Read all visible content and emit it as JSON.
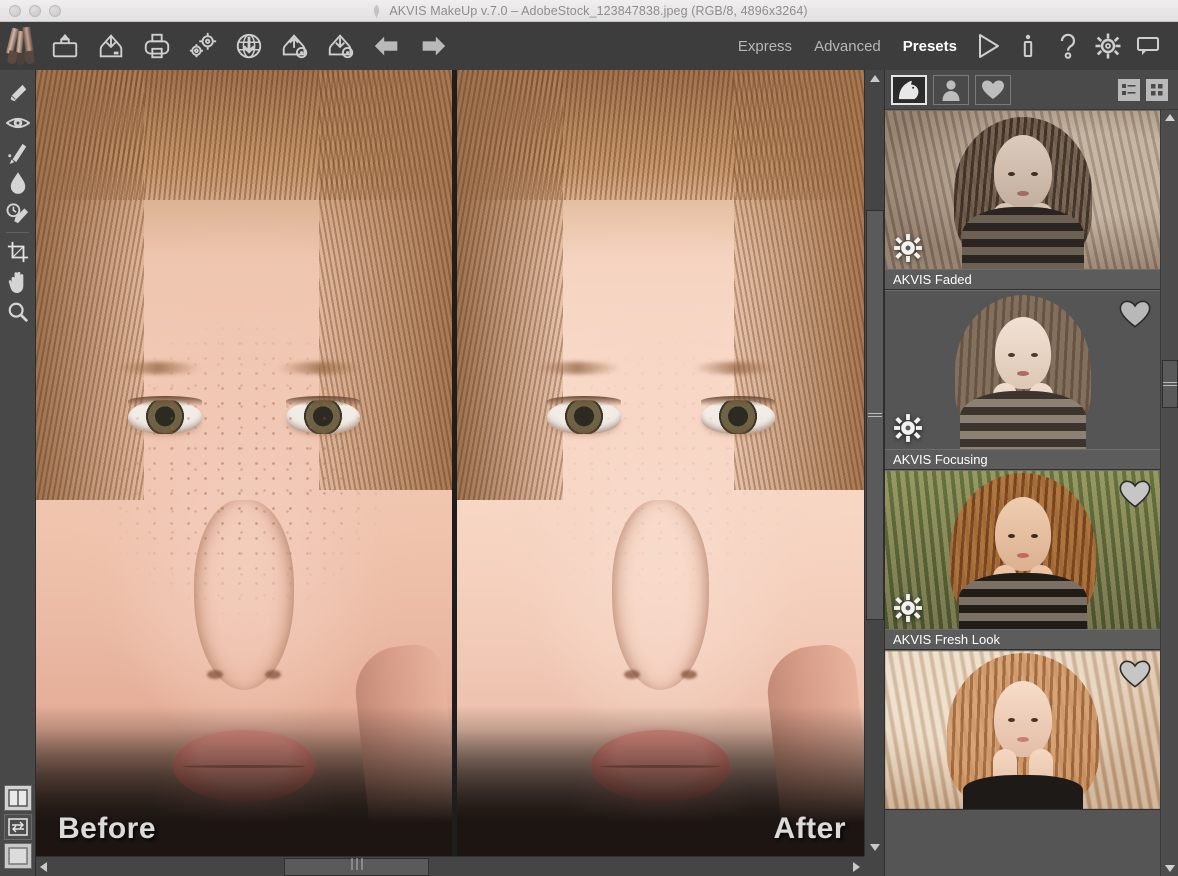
{
  "window": {
    "title": "AKVIS MakeUp v.7.0 – AdobeStock_123847838.jpeg (RGB/8, 4896x3264)",
    "app_icon": "akvis-logo-icon",
    "controls": [
      "close-button",
      "minimize-button",
      "zoom-button"
    ]
  },
  "toolbar": {
    "logo_icon": "makeup-brushes-logo-icon",
    "buttons": [
      {
        "name": "open-image-button",
        "icon": "open-folder-icon",
        "tooltip": "Open Image"
      },
      {
        "name": "save-image-button",
        "icon": "save-disk-icon",
        "tooltip": "Save Image"
      },
      {
        "name": "print-image-button",
        "icon": "printer-icon",
        "tooltip": "Print Image"
      },
      {
        "name": "preferences-button",
        "icon": "gears-icon",
        "tooltip": "Preferences"
      },
      {
        "name": "publish-web-button",
        "icon": "globe-download-icon",
        "tooltip": "Publish"
      },
      {
        "name": "export-presets-button",
        "icon": "export-presets-icon",
        "tooltip": "Export Presets"
      },
      {
        "name": "import-presets-button",
        "icon": "import-presets-icon",
        "tooltip": "Import Presets"
      },
      {
        "name": "undo-button",
        "icon": "left-arrow-icon",
        "tooltip": "Undo"
      },
      {
        "name": "redo-button",
        "icon": "right-arrow-icon",
        "tooltip": "Redo"
      }
    ],
    "modes": [
      {
        "label": "Express",
        "active": false
      },
      {
        "label": "Advanced",
        "active": false
      },
      {
        "label": "Presets",
        "active": true
      }
    ],
    "right_icons": [
      {
        "name": "run-button",
        "icon": "play-triangle-icon"
      },
      {
        "name": "about-button",
        "icon": "info-icon"
      },
      {
        "name": "help-button",
        "icon": "question-mark-icon"
      },
      {
        "name": "settings-button",
        "icon": "gear-icon"
      },
      {
        "name": "comments-button",
        "icon": "speech-bubble-icon"
      }
    ]
  },
  "left_toolbar": {
    "tools": [
      {
        "name": "tool-skin-smoothing",
        "icon": "skin-brush-icon",
        "active": false
      },
      {
        "name": "tool-red-eye",
        "icon": "eye-icon",
        "active": false
      },
      {
        "name": "tool-brush",
        "icon": "paint-brush-icon",
        "active": false
      },
      {
        "name": "tool-blur",
        "icon": "water-drop-icon",
        "active": false
      },
      {
        "name": "tool-history-brush",
        "icon": "history-brush-icon",
        "active": false
      },
      {
        "name": "tool-crop",
        "icon": "crop-icon",
        "active": false
      },
      {
        "name": "tool-hand",
        "icon": "hand-icon",
        "active": false
      },
      {
        "name": "tool-zoom",
        "icon": "magnifier-icon",
        "active": false
      }
    ],
    "view_modes": [
      {
        "name": "view-split-before-after",
        "icon": "split-view-icon",
        "active": true
      },
      {
        "name": "view-swap-before-after",
        "icon": "swap-view-icon",
        "active": false
      },
      {
        "name": "view-single",
        "icon": "single-view-icon",
        "active": false
      }
    ]
  },
  "canvas": {
    "before_label": "Before",
    "after_label": "After",
    "h_scrollbar": {
      "name": "canvas-h-scrollbar",
      "thumb_left_pct": 30,
      "thumb_width_pct": 31
    },
    "v_scrollbar": {
      "name": "canvas-v-scrollbar",
      "thumb_top_pct": 18,
      "thumb_height_pct": 52
    }
  },
  "right_panel": {
    "tabs": [
      {
        "name": "tab-akvis-presets",
        "icon": "akvis-horse-icon",
        "active": true
      },
      {
        "name": "tab-user-presets",
        "icon": "person-icon",
        "active": false
      },
      {
        "name": "tab-favorites",
        "icon": "heart-icon",
        "active": false
      }
    ],
    "view_buttons": [
      {
        "name": "view-list-button",
        "icon": "list-view-icon"
      },
      {
        "name": "view-grid-button",
        "icon": "grid-view-icon"
      }
    ],
    "presets": [
      {
        "label": "AKVIS Faded",
        "badge": "gear",
        "scene": "sepia"
      },
      {
        "label": "AKVIS Focusing",
        "badge": "heart",
        "scene": "soft"
      },
      {
        "label": "AKVIS Fresh Look",
        "badge": "heart",
        "scene": "vivid"
      },
      {
        "label": "",
        "badge": "heart",
        "scene": "warm"
      }
    ],
    "scroll": {
      "name": "presets-scrollbar",
      "thumb_top_pct": 33,
      "thumb_height_pct": 6
    }
  },
  "colors": {
    "toolbar_bg": "#3d3d3d",
    "panel_bg": "#4a4a4a",
    "tool_bg": "#484848",
    "canvas_bg": "#2b2b2b",
    "accent_text": "#ffffff",
    "muted_text": "#b7b7b7",
    "titlebar_bg": "#eceaea"
  }
}
